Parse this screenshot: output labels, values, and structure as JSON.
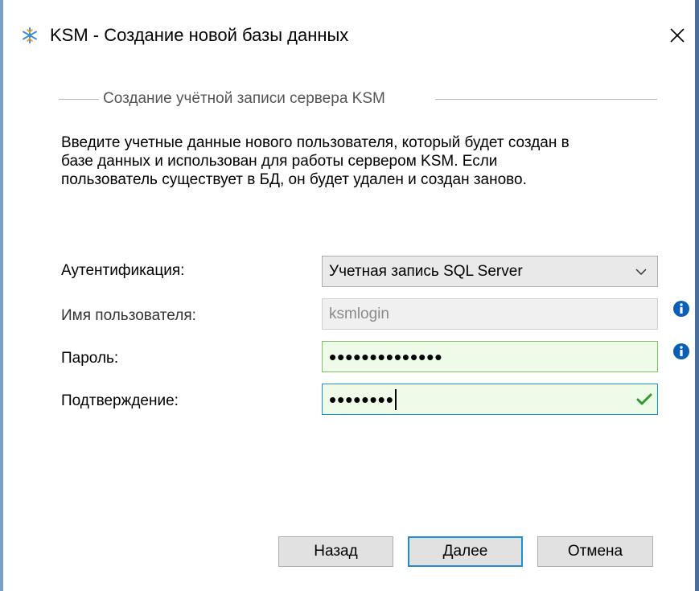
{
  "window": {
    "title": "KSM - Создание новой базы данных",
    "icon": "ksm-snowflake-icon",
    "close_icon": "close-icon"
  },
  "group": {
    "title": "Создание учётной записи сервера KSM"
  },
  "description": {
    "line1": "Введите учетные данные нового пользователя, который будет создан в",
    "line2": "базе данных и использован для работы сервером KSM. Если",
    "line3": "пользователь существует в БД, он будет удален и создан заново."
  },
  "form": {
    "auth_label": "Аутентификация:",
    "auth_value": "Учетная запись SQL Server",
    "username_label": "Имя пользователя:",
    "username_value": "ksmlogin",
    "password_label": "Пароль:",
    "password_value": "••••••••••••••",
    "confirm_label": "Подтверждение:",
    "confirm_value": "••••••••"
  },
  "buttons": {
    "back": "Назад",
    "next": "Далее",
    "cancel": "Отмена"
  },
  "colors": {
    "valid_field_bg": "#edfbe8",
    "focus_border": "#1f8dd6",
    "info_icon": "#0b5fb6",
    "check_icon": "#2e9a2e"
  }
}
